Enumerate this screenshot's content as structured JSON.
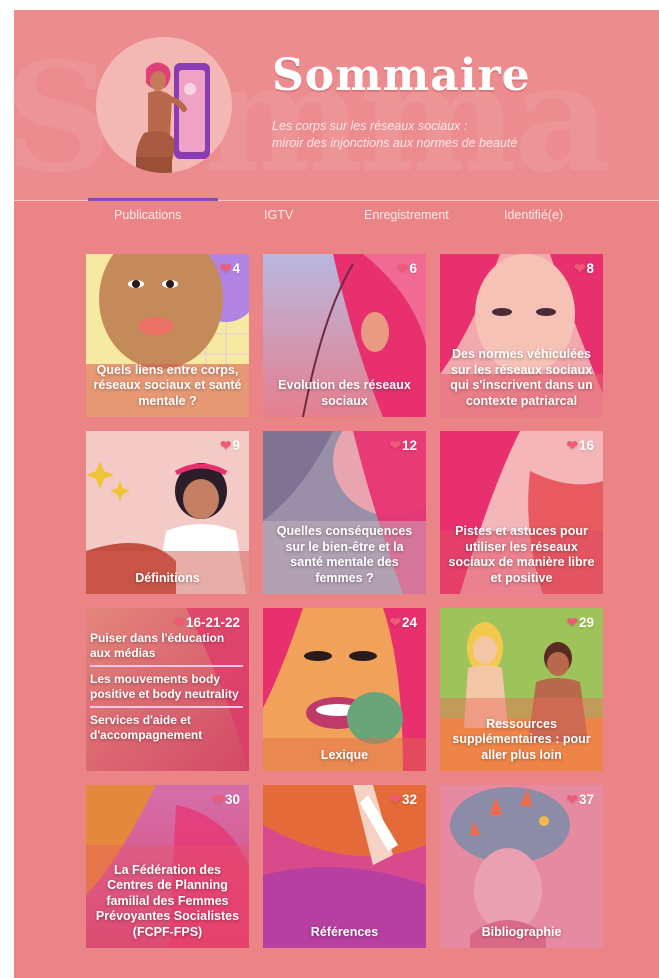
{
  "header": {
    "title": "Sommaire",
    "subtitle_line1": "Les corps sur les réseaux sociaux :",
    "subtitle_line2": "miroir des injonctions aux normes de beauté"
  },
  "tabs": [
    {
      "label": "Publications",
      "active": true
    },
    {
      "label": "IGTV",
      "active": false
    },
    {
      "label": "Enregistrement",
      "active": false
    },
    {
      "label": "Identifié(e)",
      "active": false
    }
  ],
  "tiles": [
    {
      "likes": "4",
      "caption": "Quels liens entre corps, réseaux sociaux et santé mentale ?"
    },
    {
      "likes": "6",
      "caption": "Evolution des réseaux sociaux"
    },
    {
      "likes": "8",
      "caption": "Des normes véhiculées sur les réseaux sociaux qui s'inscrivent dans un contexte patriarcal"
    },
    {
      "likes": "9",
      "caption": "Définitions"
    },
    {
      "likes": "12",
      "caption": "Quelles conséquences sur le bien-être et la santé mentale des femmes ?"
    },
    {
      "likes": "16",
      "caption": "Pistes et astuces pour utiliser les réseaux sociaux de manière libre et positive"
    },
    {
      "likes": "16-21-22",
      "links": [
        "Puiser dans l'éducation aux médias",
        "Les mouvements body positive et body neutrality",
        "Services d'aide et d'accompagnement"
      ]
    },
    {
      "likes": "24",
      "caption": "Lexique"
    },
    {
      "likes": "29",
      "caption": "Ressources supplémentaires : pour aller plus loin"
    },
    {
      "likes": "30",
      "caption": "La Fédération des Centres de Planning familial des Femmes Prévoyantes Socialistes (FCPF-FPS)"
    },
    {
      "likes": "32",
      "caption": "Références"
    },
    {
      "likes": "37",
      "caption": "Bibliographie"
    }
  ],
  "colors": {
    "page_background": "#ea8486",
    "header_background": "#ec8c8f",
    "tab_indicator": "#7f4fb9",
    "heart": "#ef5b74"
  },
  "icons": {
    "like": "heart-icon"
  }
}
